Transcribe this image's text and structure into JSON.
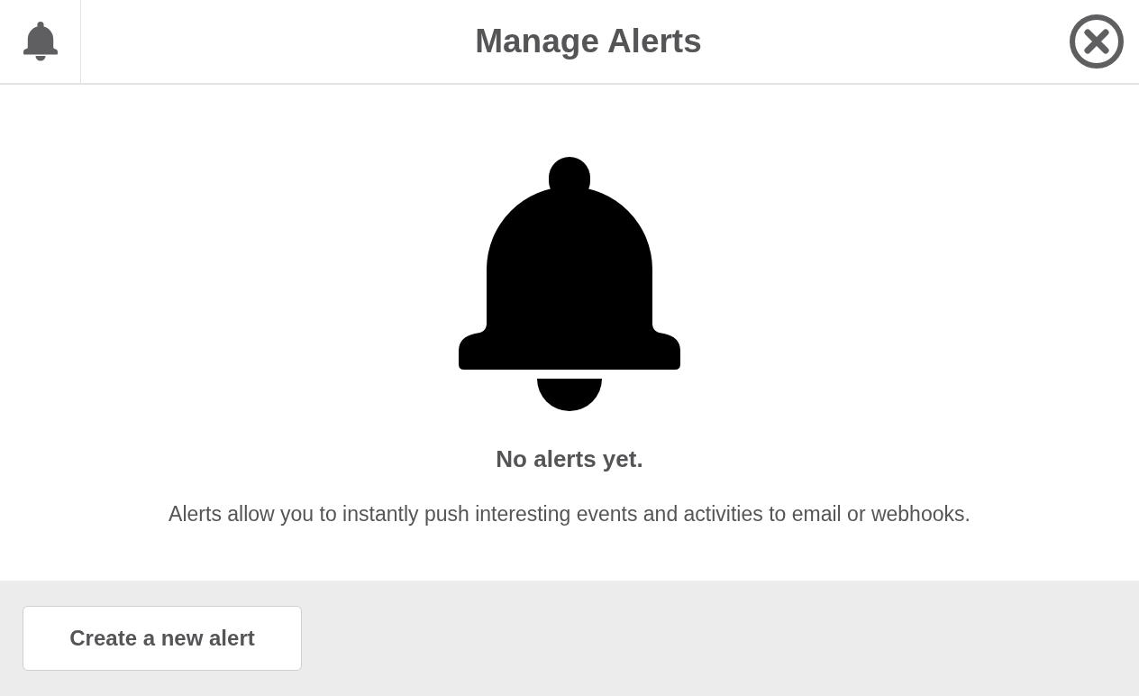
{
  "header": {
    "title": "Manage Alerts"
  },
  "empty_state": {
    "title": "No alerts yet.",
    "description": "Alerts allow you to instantly push interesting events and activities to email or webhooks."
  },
  "footer": {
    "button": "Create a new alert"
  }
}
